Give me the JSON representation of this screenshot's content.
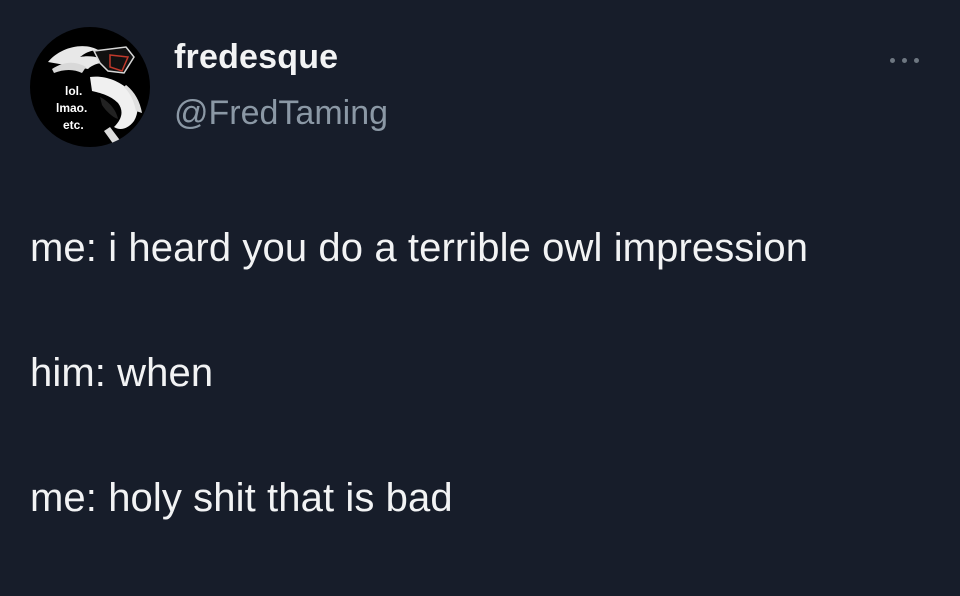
{
  "tweet": {
    "author": {
      "display_name": "fredesque",
      "handle": "@FredTaming",
      "avatar_text": [
        "lol.",
        "lmao.",
        "etc."
      ]
    },
    "more_icon": "more-horizontal-icon",
    "lines": [
      "me: i heard you do a terrible owl impression",
      "him: when",
      "me: holy shit that is bad"
    ]
  },
  "colors": {
    "background": "#171d2a",
    "text": "#f2f3f4",
    "secondary_text": "#8b98a5",
    "icon": "#6e7781"
  }
}
